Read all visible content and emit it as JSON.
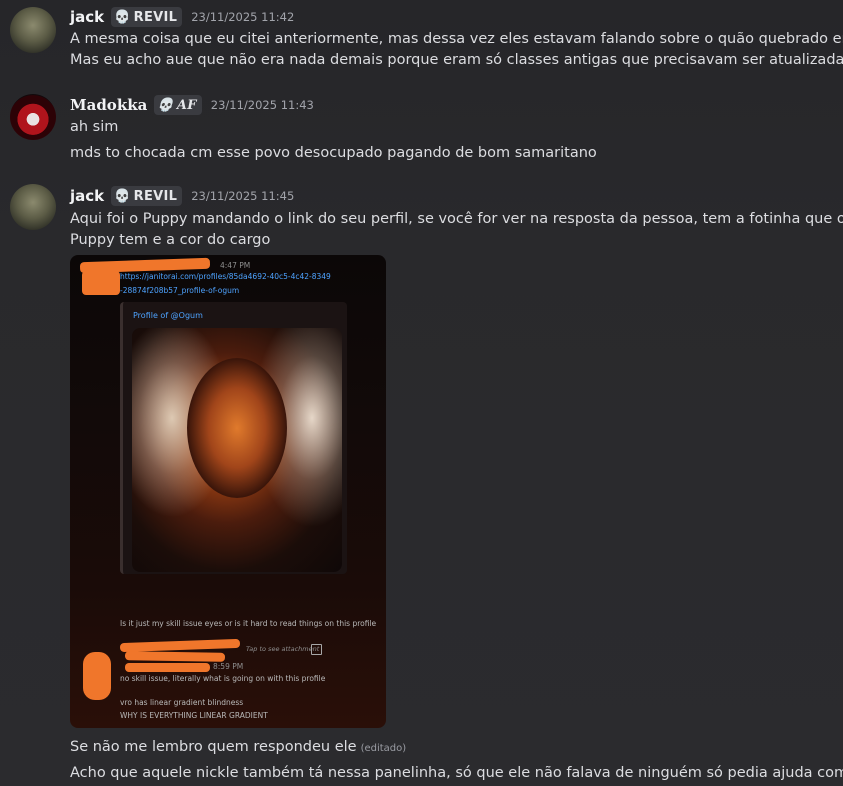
{
  "messages": [
    {
      "author": "jack",
      "role_tag": "REVIL",
      "role_icon": "skull-icon",
      "timestamp": "23/11/2025 11:42",
      "lines": [
        "A mesma coisa que eu citei anteriormente, mas dessa vez eles estavam falando sobre o quão quebrado era.",
        "Mas eu acho aue que não era nada demais porque eram só classes antigas que precisavam ser atualizadas"
      ]
    },
    {
      "author": "Madokka",
      "role_tag": "AF",
      "role_icon": "purple-skull-icon",
      "timestamp": "23/11/2025 11:43",
      "lines": [
        "ah sim",
        "mds to chocada cm esse povo desocupado pagando de bom samaritano"
      ]
    },
    {
      "author": "jack",
      "role_tag": "REVIL",
      "role_icon": "skull-icon",
      "timestamp": "23/11/2025 11:45",
      "lines": [
        "Aqui foi o Puppy mandando o link do seu perfil, se você for ver na resposta da pessoa, tem a fotinha que o",
        "Puppy tem e a cor do cargo"
      ],
      "after_image_lines": [
        "Se não me lembro quem respondeu ele",
        "Acho que aquele nickle também tá nessa panelinha, só que ele não falava de ninguém só pedia ajuda com css"
      ],
      "edited_label": "(editado)"
    }
  ],
  "embed": {
    "time1": "4:47 PM",
    "link_line1": "https://janitorai.com/profiles/85da4692-40c5-4c42-8349",
    "link_line2": "-28874f208b57_profile-of-ogum",
    "card_title": "Profile of @Ogum",
    "question": "Is it just my skill issue eyes or is it hard to read things on this profile",
    "tap_label": "Tap to see attachment",
    "time2": "8:59 PM",
    "reply1": "no skill issue, literally what is going on with this profile",
    "reply2": "vro has linear gradient blindness",
    "reply3": "WHY IS EVERYTHING LINEAR GRADIENT"
  },
  "colors": {
    "background": "#2b2b2e",
    "text": "#dcdde1",
    "timestamp": "#a2a4ab",
    "tag_bg": "#3a3b40",
    "scribble": "#f0762b",
    "link": "#4ea3ff"
  }
}
